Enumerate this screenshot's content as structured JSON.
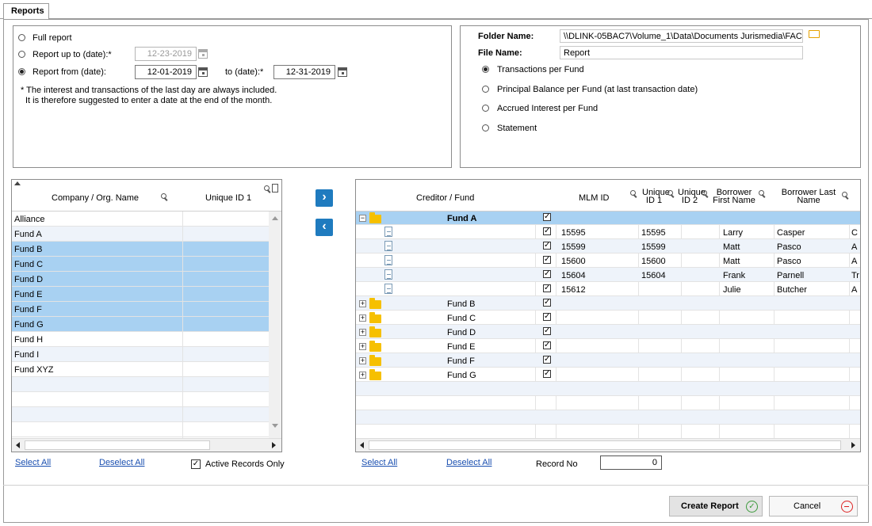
{
  "tab": {
    "label": "Reports"
  },
  "options": {
    "full_report": "Full report",
    "report_up_to": "Report up to (date):*",
    "report_up_to_value": "12-23-2019",
    "report_from": "Report from (date):",
    "report_from_value": "12-01-2019",
    "to_date": "to (date):*",
    "to_date_value": "12-31-2019",
    "note_line1": "* The interest and transactions of the last day are always included.",
    "note_line2": "It is therefore suggested to enter a date at the end of the month."
  },
  "output": {
    "folder_label": "Folder Name:",
    "folder_value": "\\\\DLINK-05BAC7\\Volume_1\\Data\\Documents Jurismedia\\FAC",
    "file_label": "File Name:",
    "file_value": "Report",
    "type_options": [
      "Transactions per Fund",
      "Principal Balance per Fund (at last transaction date)",
      "Accrued Interest per Fund",
      "Statement"
    ]
  },
  "left_grid": {
    "col_company": "Company  / Org. Name",
    "col_unique": "Unique ID 1",
    "rows": [
      "Alliance",
      "Fund A",
      "Fund B",
      "Fund C",
      "Fund D",
      "Fund E",
      "Fund F",
      "Fund G",
      "Fund H",
      "Fund I",
      "Fund XYZ"
    ],
    "select_all": "Select All",
    "deselect_all": "Deselect All",
    "active_only": "Active Records Only"
  },
  "right_grid": {
    "col_creditor": "Creditor / Fund",
    "col_mlm": "MLM ID",
    "col_unique1_a": "Unique",
    "col_unique1_b": "ID 1",
    "col_unique2_a": "Unique",
    "col_unique2_b": "ID 2",
    "col_first_a": "Borrower",
    "col_first_b": "First Name",
    "col_last_a": "Borrower Last",
    "col_last_b": "Name",
    "fund_a": "Fund A",
    "details": [
      {
        "mlm": "15595",
        "uid": "15595",
        "first": "Larry",
        "last": "Casper",
        "extra": "C"
      },
      {
        "mlm": "15599",
        "uid": "15599",
        "first": "Matt",
        "last": "Pasco",
        "extra": "A"
      },
      {
        "mlm": "15600",
        "uid": "15600",
        "first": "Matt",
        "last": "Pasco",
        "extra": "A"
      },
      {
        "mlm": "15604",
        "uid": "15604",
        "first": "Frank",
        "last": "Parnell",
        "extra": "Tr"
      },
      {
        "mlm": "15612",
        "uid": "",
        "first": "Julie",
        "last": "Butcher",
        "extra": "A"
      }
    ],
    "funds": [
      "Fund B",
      "Fund C",
      "Fund D",
      "Fund E",
      "Fund F",
      "Fund G"
    ],
    "select_all": "Select All",
    "deselect_all": "Deselect All",
    "record_no_label": "Record No",
    "record_no_value": "0"
  },
  "buttons": {
    "create": "Create Report",
    "cancel": "Cancel"
  },
  "colors": {
    "selected_row": "#a8d1f2",
    "nav_button": "#1f7bbf",
    "link": "#1a4fb0"
  }
}
